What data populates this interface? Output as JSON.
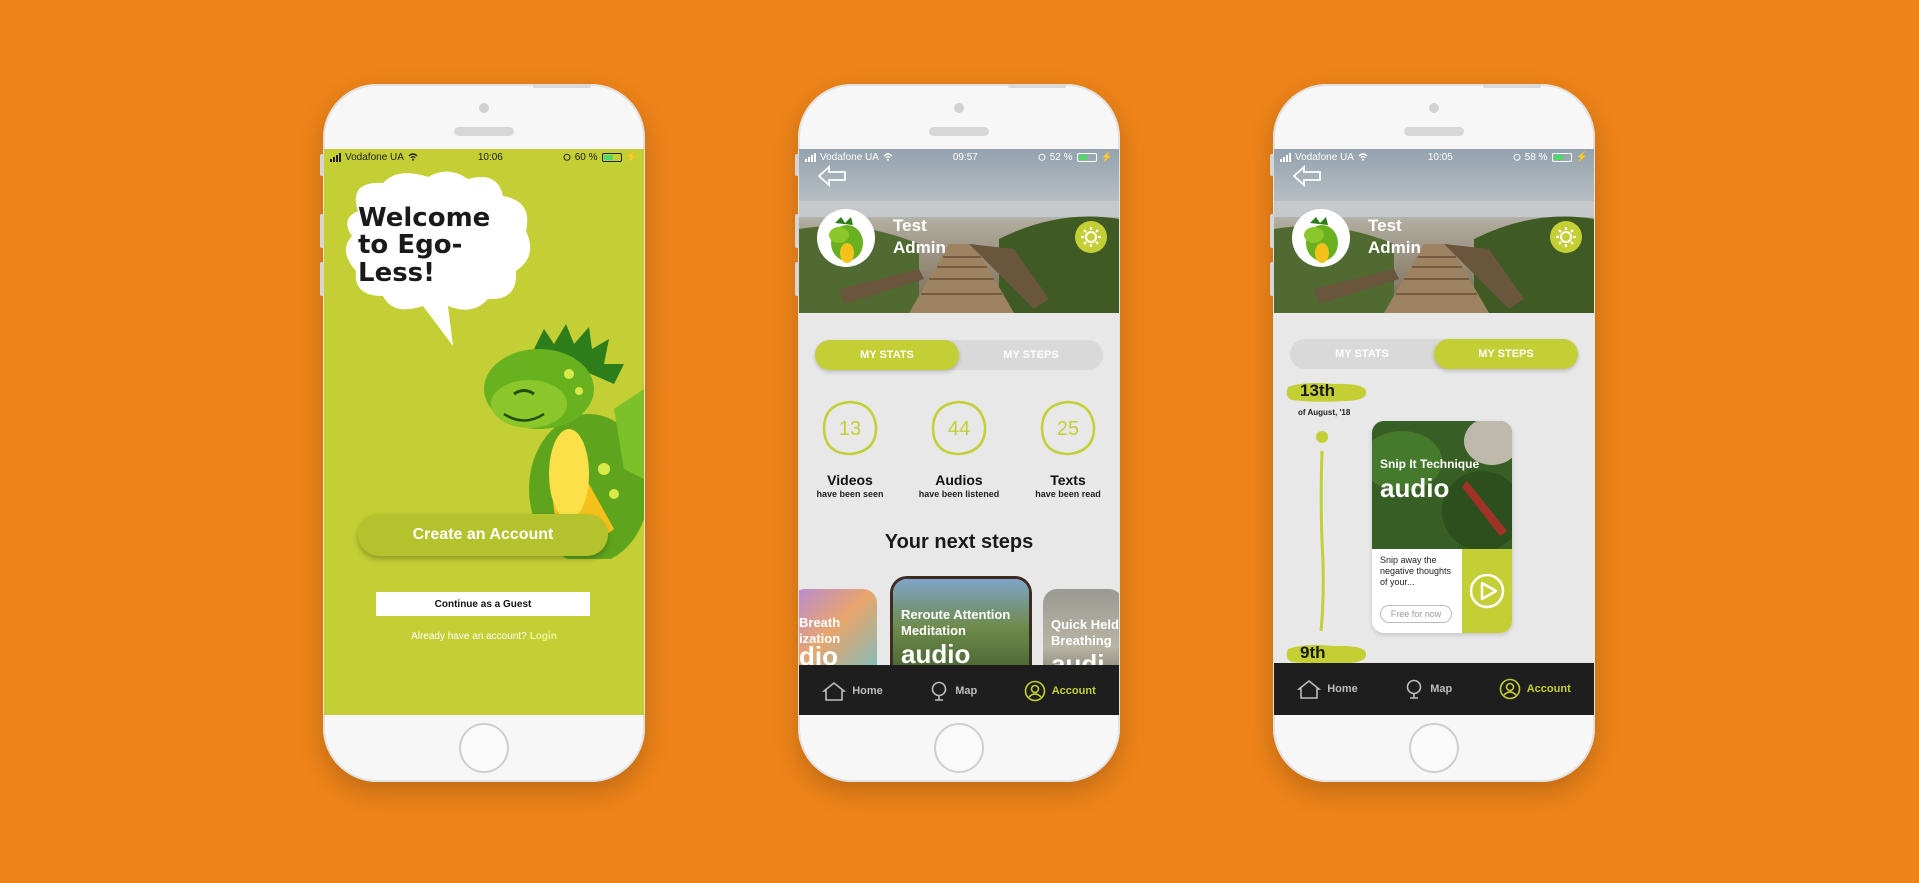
{
  "colors": {
    "background": "#ee8419",
    "accent": "#c3cf34",
    "nav_bg": "#1e1e1e"
  },
  "phone1": {
    "status": {
      "carrier": "Vodafone UA",
      "time": "10:06",
      "battery": "60 %",
      "battery_level": 0.6
    },
    "welcome_title": "Welcome to Ego-Less!",
    "create_account_label": "Create an Account",
    "guest_label": "Continue as a Guest",
    "login_prompt": "Already have an account?",
    "login_link": "Login"
  },
  "phone2": {
    "status": {
      "carrier": "Vodafone UA",
      "time": "09:57",
      "battery": "52 %",
      "battery_level": 0.52
    },
    "user_name": "Test Admin",
    "tabs": [
      {
        "label": "MY STATS",
        "active": true
      },
      {
        "label": "MY STEPS",
        "active": false
      }
    ],
    "stats": [
      {
        "value": "13",
        "label": "Videos",
        "sub": "have been seen"
      },
      {
        "value": "44",
        "label": "Audios",
        "sub": "have been listened"
      },
      {
        "value": "25",
        "label": "Texts",
        "sub": "have been read"
      }
    ],
    "next_steps_title": "Your next steps",
    "cards": [
      {
        "title": "Breath\nization",
        "type": "dio"
      },
      {
        "title": "Reroute Attention Meditation",
        "type": "audio"
      },
      {
        "title": "Quick Held Breathing",
        "type": "audi"
      }
    ],
    "nav": [
      {
        "label": "Home",
        "icon": "home-icon"
      },
      {
        "label": "Map",
        "icon": "globe-icon"
      },
      {
        "label": "Account",
        "icon": "account-icon",
        "active": true
      }
    ]
  },
  "phone3": {
    "status": {
      "carrier": "Vodafone UA",
      "time": "10:05",
      "battery": "58 %",
      "battery_level": 0.58
    },
    "user_name": "Test Admin",
    "tabs": [
      {
        "label": "MY STATS",
        "active": false
      },
      {
        "label": "MY STEPS",
        "active": true
      }
    ],
    "date1": "13th",
    "date1_sub": "of August, '18",
    "date2": "9th",
    "step": {
      "title": "Snip It Technique",
      "type": "audio",
      "description": "Snip away the negative thoughts of your...",
      "badge": "Free for now"
    },
    "nav": [
      {
        "label": "Home",
        "icon": "home-icon"
      },
      {
        "label": "Map",
        "icon": "globe-icon"
      },
      {
        "label": "Account",
        "icon": "account-icon",
        "active": true
      }
    ]
  }
}
